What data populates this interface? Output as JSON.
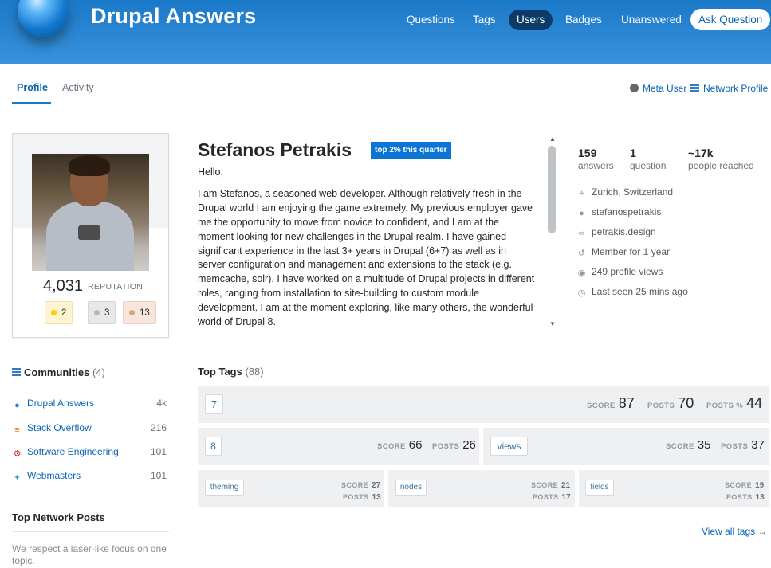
{
  "header": {
    "site_title": "Drupal Answers",
    "nav": [
      "Questions",
      "Tags",
      "Users",
      "Badges",
      "Unanswered"
    ],
    "active_nav": "Users",
    "ask_button": "Ask Question"
  },
  "subtabs": {
    "profile": "Profile",
    "activity": "Activity",
    "meta_user": "Meta User",
    "network_profile": "Network Profile"
  },
  "profile": {
    "reputation": "4,031",
    "reputation_label": "REPUTATION",
    "badges": {
      "gold": "2",
      "silver": "3",
      "bronze": "13"
    },
    "name": "Stefanos Petrakis",
    "top_badge": "top 2% this quarter",
    "bio_greeting": "Hello,",
    "bio_text": "I am Stefanos, a seasoned web developer. Although relatively fresh in the Drupal world I am enjoying the game extremely. My previous employer gave me the opportunity to move from novice to confident, and I am at the moment looking for new challenges in the Drupal realm. I have gained significant experience in the last 3+ years in Drupal (6+7) as well as in server configuration and management and extensions to the stack (e.g. memcache, solr). I have worked on a multitude of Drupal projects in different roles, ranging from installation to site-building to custom module development. I am at the moment exploring, like many others, the wonderful world of Drupal 8."
  },
  "stats": {
    "answers": {
      "value": "159",
      "label": "answers"
    },
    "questions": {
      "value": "1",
      "label": "question"
    },
    "reached": {
      "value": "~17k",
      "label": "people reached"
    }
  },
  "info": {
    "location": "Zurich, Switzerland",
    "github": "stefanospetrakis",
    "website": "petrakis.design",
    "member_for": "Member for 1 year",
    "profile_views": "249 profile views",
    "last_seen": "Last seen 25 mins ago"
  },
  "communities": {
    "title": "Communities",
    "count": "(4)",
    "items": [
      {
        "name": "Drupal Answers",
        "rep": "4k",
        "color": "#1e88d8"
      },
      {
        "name": "Stack Overflow",
        "rep": "216",
        "color": "#f48024"
      },
      {
        "name": "Software Engineering",
        "rep": "101",
        "color": "#c9342d"
      },
      {
        "name": "Webmasters",
        "rep": "101",
        "color": "#3da8b8"
      }
    ]
  },
  "top_network_posts": {
    "title": "Top Network Posts",
    "text": "We respect a laser-like focus on one topic."
  },
  "top_tags": {
    "title": "Top Tags",
    "count": "(88)",
    "score_label": "SCORE",
    "posts_label": "POSTS",
    "posts_pct_label": "POSTS %",
    "tags": [
      {
        "name": "7",
        "score": "87",
        "posts": "70",
        "posts_pct": "44"
      },
      {
        "name": "8",
        "score": "66",
        "posts": "26"
      },
      {
        "name": "views",
        "score": "35",
        "posts": "37"
      },
      {
        "name": "theming",
        "score": "27",
        "posts": "13"
      },
      {
        "name": "nodes",
        "score": "21",
        "posts": "17"
      },
      {
        "name": "fields",
        "score": "19",
        "posts": "13"
      }
    ],
    "view_all": "View all tags →"
  }
}
